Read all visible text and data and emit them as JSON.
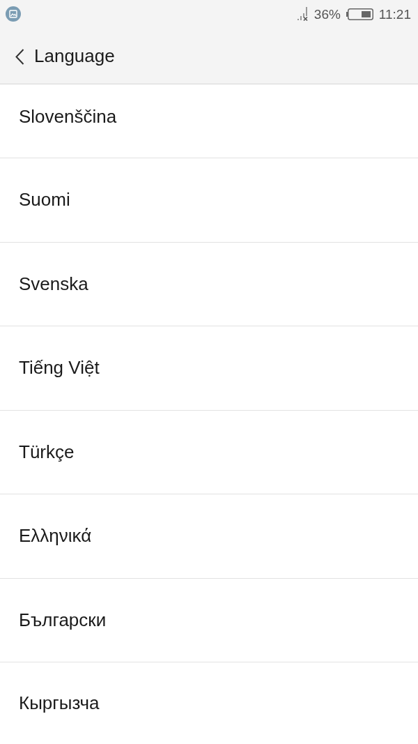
{
  "status_bar": {
    "battery_percent": "36%",
    "time": "11:21"
  },
  "header": {
    "title": "Language"
  },
  "languages": [
    {
      "label": "Slovenščina"
    },
    {
      "label": "Suomi"
    },
    {
      "label": "Svenska"
    },
    {
      "label": "Tiếng Việt"
    },
    {
      "label": "Türkçe"
    },
    {
      "label": "Ελληνικά"
    },
    {
      "label": "Български"
    },
    {
      "label": "Кыргызча"
    }
  ]
}
